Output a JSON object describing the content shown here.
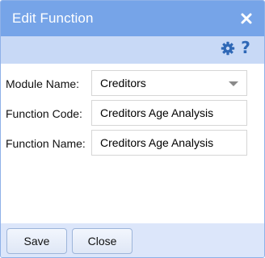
{
  "dialog": {
    "title": "Edit Function",
    "close_icon": "close-icon",
    "toolbar": {
      "settings_icon": "gear-icon",
      "help_icon": "help-icon",
      "help_glyph": "?"
    }
  },
  "form": {
    "module_name": {
      "label": "Module Name:",
      "value": "Creditors"
    },
    "function_code": {
      "label": "Function Code:",
      "value": "Creditors Age Analysis"
    },
    "function_name": {
      "label": "Function Name:",
      "value": "Creditors Age Analysis"
    }
  },
  "footer": {
    "save_label": "Save",
    "close_label": "Close"
  },
  "colors": {
    "titlebar": "#76a4e8",
    "toolbar": "#c8d9f6",
    "icon_blue": "#2f68b6"
  }
}
